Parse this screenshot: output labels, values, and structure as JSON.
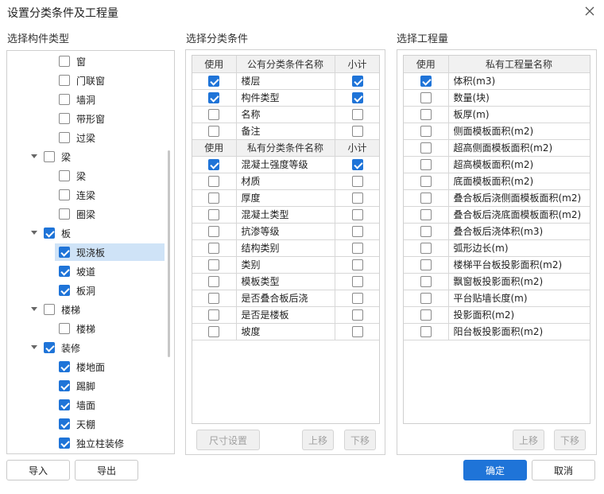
{
  "window": {
    "title": "设置分类条件及工程量",
    "close_icon": "close-icon"
  },
  "left": {
    "label": "选择构件类型",
    "items": [
      {
        "label": "窗",
        "checked": false
      },
      {
        "label": "门联窗",
        "checked": false
      },
      {
        "label": "墙洞",
        "checked": false
      },
      {
        "label": "带形窗",
        "checked": false
      },
      {
        "label": "过梁",
        "checked": false
      },
      {
        "label": "梁",
        "checked": false
      },
      {
        "label": "梁",
        "checked": false
      },
      {
        "label": "连梁",
        "checked": false
      },
      {
        "label": "圈梁",
        "checked": false
      },
      {
        "label": "板",
        "checked": true
      },
      {
        "label": "现浇板",
        "checked": true
      },
      {
        "label": "坡道",
        "checked": true
      },
      {
        "label": "板洞",
        "checked": true
      },
      {
        "label": "楼梯",
        "checked": false
      },
      {
        "label": "楼梯",
        "checked": false
      },
      {
        "label": "装修",
        "checked": true
      },
      {
        "label": "楼地面",
        "checked": true
      },
      {
        "label": "踢脚",
        "checked": true
      },
      {
        "label": "墙面",
        "checked": true
      },
      {
        "label": "天棚",
        "checked": true
      },
      {
        "label": "独立柱装修",
        "checked": true
      }
    ],
    "import_label": "导入",
    "export_label": "导出"
  },
  "middle": {
    "label": "选择分类条件",
    "public_header": {
      "use": "使用",
      "name": "公有分类条件名称",
      "subtotal": "小计"
    },
    "public_rows": [
      {
        "use": true,
        "name": "楼层",
        "subtotal": true
      },
      {
        "use": true,
        "name": "构件类型",
        "subtotal": true
      },
      {
        "use": false,
        "name": "名称",
        "subtotal": false
      },
      {
        "use": false,
        "name": "备注",
        "subtotal": false
      }
    ],
    "private_header": {
      "use": "使用",
      "name": "私有分类条件名称",
      "subtotal": "小计"
    },
    "private_rows": [
      {
        "use": true,
        "name": "混凝土强度等级",
        "subtotal": true
      },
      {
        "use": false,
        "name": "材质",
        "subtotal": false
      },
      {
        "use": false,
        "name": "厚度",
        "subtotal": false
      },
      {
        "use": false,
        "name": "混凝土类型",
        "subtotal": false
      },
      {
        "use": false,
        "name": "抗渗等级",
        "subtotal": false
      },
      {
        "use": false,
        "name": "结构类别",
        "subtotal": false
      },
      {
        "use": false,
        "name": "类别",
        "subtotal": false
      },
      {
        "use": false,
        "name": "模板类型",
        "subtotal": false
      },
      {
        "use": false,
        "name": "是否叠合板后浇",
        "subtotal": false
      },
      {
        "use": false,
        "name": "是否是楼板",
        "subtotal": false
      },
      {
        "use": false,
        "name": "坡度",
        "subtotal": false
      }
    ],
    "size_label": "尺寸设置",
    "up_label": "上移",
    "down_label": "下移"
  },
  "right": {
    "label": "选择工程量",
    "header": {
      "use": "使用",
      "name": "私有工程量名称"
    },
    "rows": [
      {
        "use": true,
        "name": "体积(m3)"
      },
      {
        "use": false,
        "name": "数量(块)"
      },
      {
        "use": false,
        "name": "板厚(m)"
      },
      {
        "use": false,
        "name": "侧面模板面积(m2)"
      },
      {
        "use": false,
        "name": "超高侧面模板面积(m2)"
      },
      {
        "use": false,
        "name": "超高模板面积(m2)"
      },
      {
        "use": false,
        "name": "底面模板面积(m2)"
      },
      {
        "use": false,
        "name": "叠合板后浇侧面模板面积(m2)"
      },
      {
        "use": false,
        "name": "叠合板后浇底面模板面积(m2)"
      },
      {
        "use": false,
        "name": "叠合板后浇体积(m3)"
      },
      {
        "use": false,
        "name": "弧形边长(m)"
      },
      {
        "use": false,
        "name": "楼梯平台板投影面积(m2)"
      },
      {
        "use": false,
        "name": "飘窗板投影面积(m2)"
      },
      {
        "use": false,
        "name": "平台贴墙长度(m)"
      },
      {
        "use": false,
        "name": "投影面积(m2)"
      },
      {
        "use": false,
        "name": "阳台板投影面积(m2)"
      }
    ],
    "up_label": "上移",
    "down_label": "下移"
  },
  "footer": {
    "ok_label": "确定",
    "cancel_label": "取消"
  },
  "colors": {
    "accent": "#1f74d8",
    "selected_row": "#cfe3f7"
  }
}
